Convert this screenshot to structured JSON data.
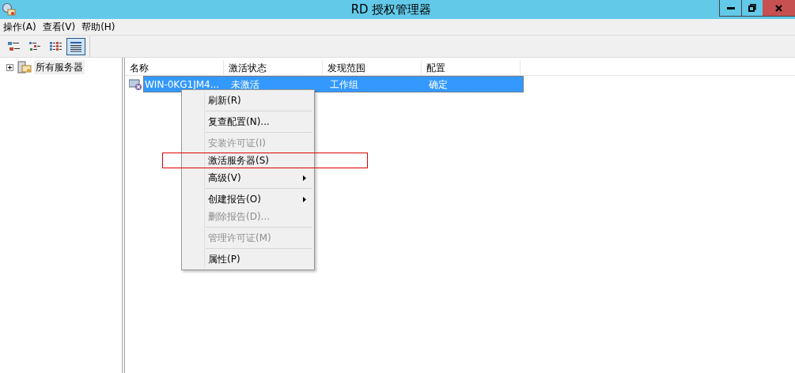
{
  "window": {
    "title": "RD 授权管理器"
  },
  "menu_bar": [
    "操作(A)",
    "查看(V)",
    "帮助(H)"
  ],
  "toolbar": [
    {
      "selected": false
    },
    {
      "selected": false
    },
    {
      "selected": false
    },
    {
      "selected": true
    }
  ],
  "tree": {
    "label": "所有服务器",
    "expanded": false
  },
  "table": {
    "columns": [
      "名称",
      "激活状态",
      "发现范围",
      "配置"
    ],
    "rows": [
      {
        "cells": [
          "WIN-0KG1JM4...",
          "未激活",
          "工作组",
          "确定"
        ],
        "selected": true
      }
    ]
  },
  "context_menu": {
    "groups": [
      [
        {
          "label": "刷新(R)",
          "disabled": false,
          "submenu": false,
          "annotated": false
        }
      ],
      [
        {
          "label": "复查配置(N)...",
          "disabled": false,
          "submenu": false,
          "annotated": false
        }
      ],
      [
        {
          "label": "安装许可证(I)",
          "disabled": true,
          "submenu": false,
          "annotated": false
        },
        {
          "label": "激活服务器(S)",
          "disabled": false,
          "submenu": false,
          "annotated": true
        },
        {
          "label": "高级(V)",
          "disabled": false,
          "submenu": true,
          "annotated": false
        }
      ],
      [
        {
          "label": "创建报告(O)",
          "disabled": false,
          "submenu": true,
          "annotated": false
        },
        {
          "label": "删除报告(D)...",
          "disabled": true,
          "submenu": false,
          "annotated": false
        }
      ],
      [
        {
          "label": "管理许可证(M)",
          "disabled": true,
          "submenu": false,
          "annotated": false
        }
      ],
      [
        {
          "label": "属性(P)",
          "disabled": false,
          "submenu": false,
          "annotated": false
        }
      ]
    ]
  }
}
